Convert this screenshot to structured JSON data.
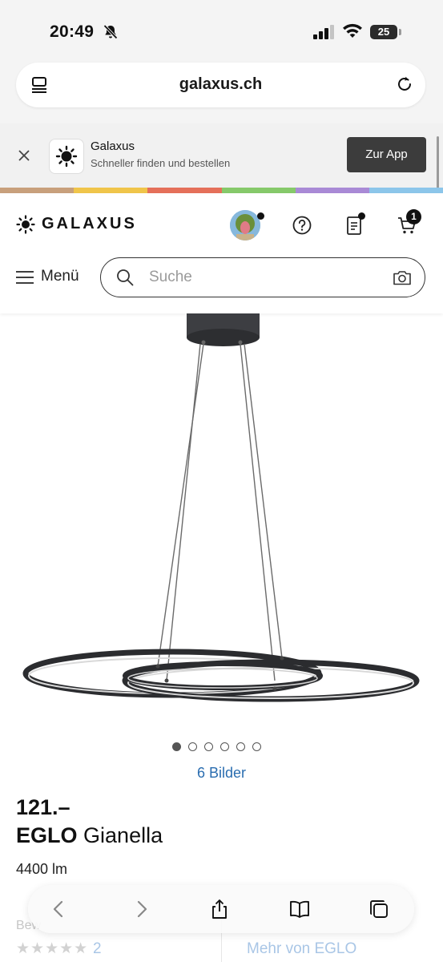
{
  "status_bar": {
    "time": "20:49",
    "battery": "25"
  },
  "browser": {
    "url": "galaxus.ch"
  },
  "app_banner": {
    "title": "Galaxus",
    "subtitle": "Schneller finden und bestellen",
    "button_label": "Zur App"
  },
  "brand_strip_colors": [
    "#c8a07c",
    "#f0c54a",
    "#e5705a",
    "#86c96a",
    "#a98ad6",
    "#8cc6ea"
  ],
  "header": {
    "logo": "GALAXUS",
    "cart_count": "1",
    "menu_label": "Menü",
    "search_placeholder": "Suche"
  },
  "gallery": {
    "image_count": 6,
    "active_index": 0,
    "link_label": "6 Bilder"
  },
  "product": {
    "price": "121.–",
    "brand": "EGLO",
    "name": "Gianella",
    "spec": "4400 lm"
  },
  "below_fold": {
    "rating_label": "Bew",
    "stars": "★★★★★",
    "rating_count": "2",
    "more_link": "Mehr von EGLO"
  },
  "toolbar": {
    "back": "back-icon",
    "forward": "forward-icon",
    "share": "share-icon",
    "bookmarks": "bookmarks-icon",
    "tabs": "tabs-icon"
  }
}
